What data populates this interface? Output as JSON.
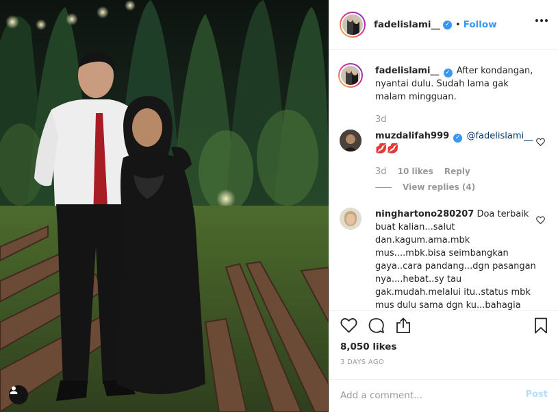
{
  "post": {
    "author": "fadelislami__",
    "follow_label": "Follow",
    "separator": "•"
  },
  "caption": {
    "user": "fadelislami__",
    "text": "After kondangan, nyantai dulu. Sudah lama gak malam mingguan.",
    "age": "3d"
  },
  "comments": [
    {
      "user": "muzdalifah999",
      "mention": "@fadelislami__",
      "emoji": "💋💋",
      "age": "3d",
      "likes": "10 likes",
      "reply_label": "Reply",
      "view_replies": "View replies (4)"
    },
    {
      "user": "ninghartono280207",
      "text": "Doa terbaik buat kalian...salut dan.kagum.ama.mbk mus....mbk.bisa seimbangkan gaya..cara pandang...dgn pasangan nya....hebat..sy tau gak.mudah.melalui itu..status mbk mus dulu sama dgn ku...bahagia"
    }
  ],
  "engagement": {
    "likes": "8,050 likes",
    "posted": "3 DAYS AGO"
  },
  "composer": {
    "placeholder": "Add a comment...",
    "post_label": "Post"
  },
  "icons": {
    "verified": "verified-badge-icon",
    "more": "more-options-icon",
    "heart": "heart-icon",
    "comment": "comment-icon",
    "share": "share-icon",
    "save": "bookmark-icon",
    "user_tag": "user-tag-icon"
  },
  "colors": {
    "accent": "#3897f0",
    "text": "#262626",
    "muted": "#999999",
    "border": "#efefef"
  }
}
